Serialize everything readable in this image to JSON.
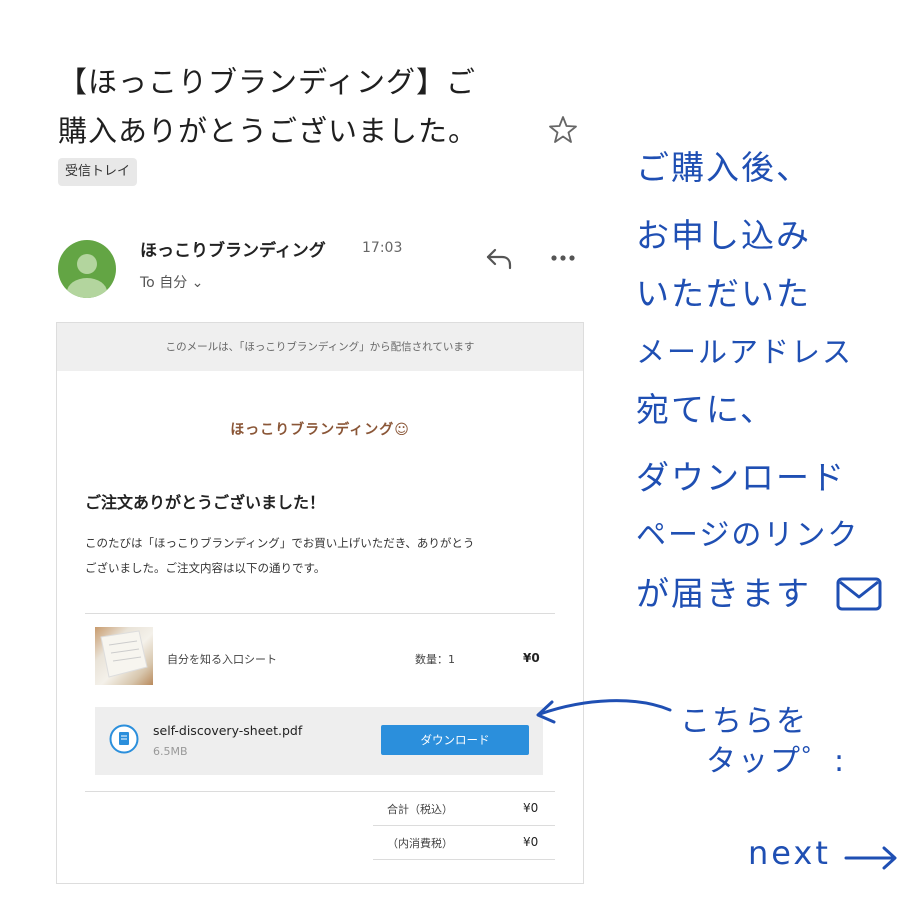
{
  "email": {
    "subject_line1": "【ほっこりブランディング】ご",
    "subject_line2": "購入ありがとうございました。",
    "label_badge": "受信トレイ",
    "sender_name": "ほっこりブランディング",
    "time": "17:03",
    "to_line": "To 自分 ⌄",
    "icons": {
      "star": "star-icon",
      "reply": "reply-icon",
      "more": "more-horizontal-icon",
      "avatar": "person-avatar-icon"
    },
    "colors": {
      "avatar": "#63a544"
    }
  },
  "body": {
    "notice": "このメールは、「ほっこりブランディング」から配信されています",
    "logo": "ほっこりブランディング☺",
    "heading": "ご注文ありがとうございました！",
    "intro_line1": "このたびは「ほっこりブランディング」でお買い上げいただき、ありがとう",
    "intro_line2": "ございました。ご注文内容は以下の通りです。",
    "product": {
      "name": "自分を知る入口シート",
      "qty": "数量：1",
      "price": "¥0"
    },
    "download": {
      "file_name": "self-discovery-sheet.pdf",
      "file_size": "6.5MB",
      "button_label": "ダウンロード",
      "button_color": "#2b8fdc"
    },
    "totals": [
      {
        "label": "合計（税込）",
        "value": "¥0"
      },
      {
        "label": "（内消費税）",
        "value": "¥0"
      }
    ]
  },
  "annotation": {
    "lines": [
      "ご購入後、",
      "お申し込み",
      "いただいた",
      "メールアドレス",
      "宛てに、",
      "ダウンロード",
      "ページのリンク",
      "が届きます"
    ],
    "mail_icon": "envelope-icon",
    "tap_line1": "こちらを",
    "tap_line2": "タップ゜:",
    "next": "next",
    "color": "#1f4fb3"
  }
}
